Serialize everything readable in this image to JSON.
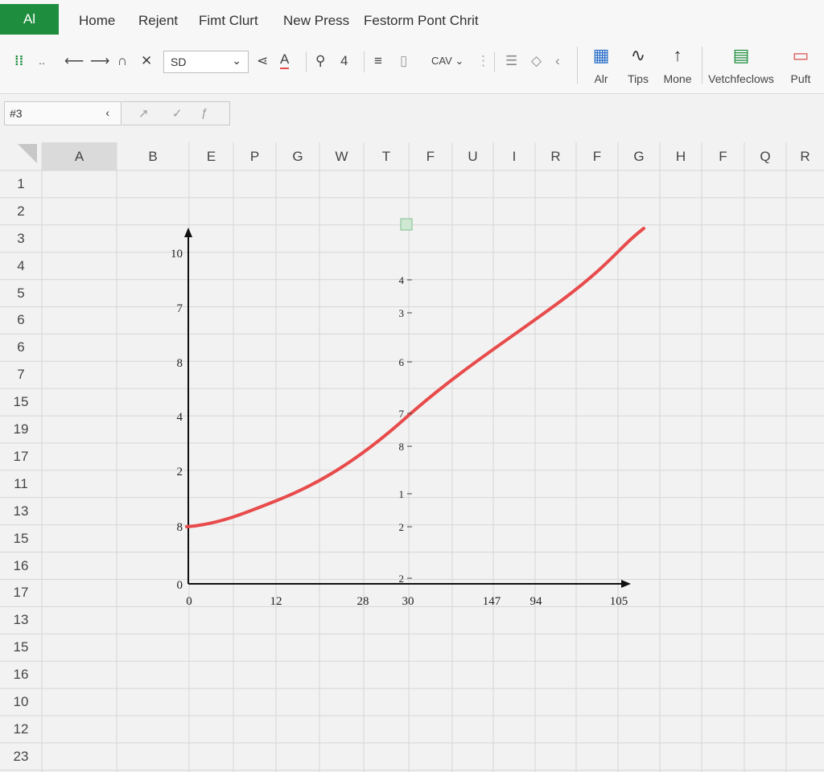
{
  "menubar": {
    "app_badge": "Al",
    "items": [
      "Home",
      "Rejent",
      "Fimt Clurt",
      "New Press",
      "Festorm Pont Chrit"
    ]
  },
  "toolbar": {
    "font_value": "SD",
    "cav_label": "CAV",
    "big_tools": [
      {
        "label": "Alr",
        "icon": "chart-insert-icon"
      },
      {
        "label": "Tips",
        "icon": "wave-icon"
      },
      {
        "label": "Mone",
        "icon": "arrow-up-icon"
      },
      {
        "label": "Vetchfeclows",
        "icon": "table-chart-icon"
      },
      {
        "label": "Puft",
        "icon": "present-icon"
      }
    ]
  },
  "formula_bar": {
    "name_box": "#3"
  },
  "sheet": {
    "columns": [
      "A",
      "B",
      "E",
      "P",
      "G",
      "W",
      "T",
      "F",
      "U",
      "I",
      "R",
      "F",
      "G",
      "H",
      "F",
      "Q",
      "R"
    ],
    "rows": [
      "1",
      "2",
      "3",
      "4",
      "5",
      "6",
      "6",
      "7",
      "15",
      "19",
      "17",
      "11",
      "13",
      "15",
      "16",
      "17",
      "13",
      "15",
      "16",
      "10",
      "12",
      "23"
    ]
  },
  "chart_data": {
    "type": "line",
    "x_ticks": [
      "0",
      "12",
      "28",
      "30",
      "147",
      "94",
      "105"
    ],
    "y_ticks_left": [
      "10",
      "7",
      "8",
      "4",
      "2",
      "8",
      "0"
    ],
    "y_ticks_right": [
      "4",
      "3",
      "6",
      "7",
      "8",
      "1",
      "2",
      "2"
    ],
    "series_color": "#e84b4b",
    "grid": true
  },
  "colors": {
    "accent": "#1e8e3e",
    "line": "#e84b4b"
  }
}
